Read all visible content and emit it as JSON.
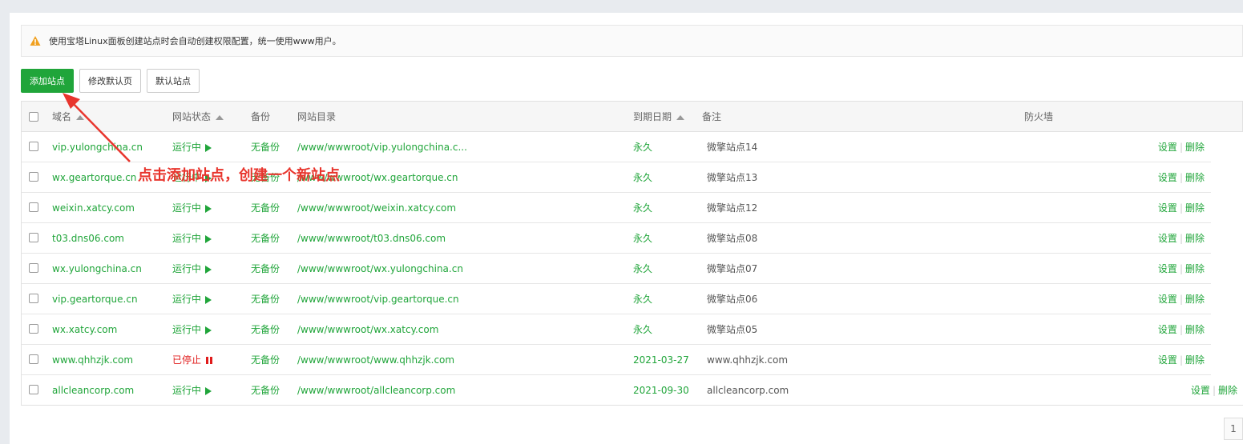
{
  "notice": {
    "text": "使用宝塔Linux面板创建站点时会自动创建权限配置，统一使用www用户。",
    "icon": "warning-icon"
  },
  "toolbar": {
    "add_site": "添加站点",
    "edit_default_page": "修改默认页",
    "default_site": "默认站点"
  },
  "table": {
    "headers": {
      "domain": "域名",
      "status": "网站状态",
      "backup": "备份",
      "root": "网站目录",
      "expire": "到期日期",
      "remark": "备注",
      "firewall": "防火墙"
    },
    "rows": [
      {
        "domain": "vip.yulongchina.cn",
        "status": "运行中",
        "running": true,
        "backup": "无备份",
        "root": "/www/wwwroot/vip.yulongchina.c...",
        "expire": "永久",
        "remark": "微擎站点14"
      },
      {
        "domain": "wx.geartorque.cn",
        "status": "运行中",
        "running": true,
        "backup": "无备份",
        "root": "/www/wwwroot/wx.geartorque.cn",
        "expire": "永久",
        "remark": "微擎站点13"
      },
      {
        "domain": "weixin.xatcy.com",
        "status": "运行中",
        "running": true,
        "backup": "无备份",
        "root": "/www/wwwroot/weixin.xatcy.com",
        "expire": "永久",
        "remark": "微擎站点12"
      },
      {
        "domain": "t03.dns06.com",
        "status": "运行中",
        "running": true,
        "backup": "无备份",
        "root": "/www/wwwroot/t03.dns06.com",
        "expire": "永久",
        "remark": "微擎站点08"
      },
      {
        "domain": "wx.yulongchina.cn",
        "status": "运行中",
        "running": true,
        "backup": "无备份",
        "root": "/www/wwwroot/wx.yulongchina.cn",
        "expire": "永久",
        "remark": "微擎站点07"
      },
      {
        "domain": "vip.geartorque.cn",
        "status": "运行中",
        "running": true,
        "backup": "无备份",
        "root": "/www/wwwroot/vip.geartorque.cn",
        "expire": "永久",
        "remark": "微擎站点06"
      },
      {
        "domain": "wx.xatcy.com",
        "status": "运行中",
        "running": true,
        "backup": "无备份",
        "root": "/www/wwwroot/wx.xatcy.com",
        "expire": "永久",
        "remark": "微擎站点05"
      },
      {
        "domain": "www.qhhzjk.com",
        "status": "已停止",
        "running": false,
        "backup": "无备份",
        "root": "/www/wwwroot/www.qhhzjk.com",
        "expire": "2021-03-27",
        "remark": "www.qhhzjk.com"
      },
      {
        "domain": "allcleancorp.com",
        "status": "运行中",
        "running": true,
        "backup": "无备份",
        "root": "/www/wwwroot/allcleancorp.com",
        "expire": "2021-09-30",
        "remark": "allcleancorp.com"
      }
    ],
    "actions": {
      "settings": "设置",
      "separator": "|",
      "delete": "删除"
    }
  },
  "annotation": {
    "text": "点击添加站点，创建一个新站点"
  },
  "pagination": {
    "current": "1"
  },
  "colors": {
    "accent": "#20a53a",
    "stopped": "#e01b1b",
    "annotation": "#e8352d"
  }
}
